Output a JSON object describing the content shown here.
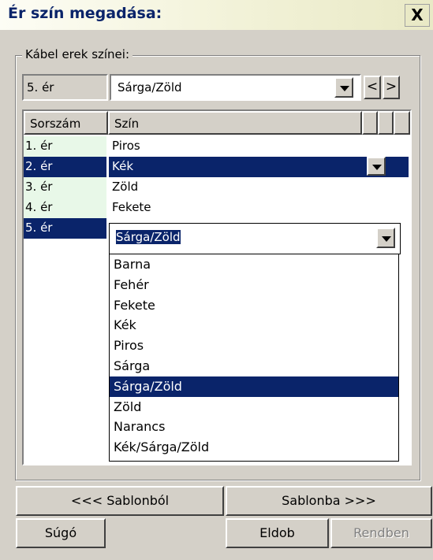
{
  "window": {
    "title": "Ér szín megadása:",
    "close_label": "X"
  },
  "group": {
    "label": "Kábel erek színei:"
  },
  "current": {
    "wire": "5. ér",
    "color": "Sárga/Zöld"
  },
  "nav": {
    "prev": "<",
    "next": ">"
  },
  "table": {
    "headers": [
      "Sorszám",
      "Szín"
    ],
    "rows": [
      {
        "num": "1. ér",
        "color": "Piros"
      },
      {
        "num": "2. ér",
        "color": "Kék"
      },
      {
        "num": "3. ér",
        "color": "Zöld"
      },
      {
        "num": "4. ér",
        "color": "Fekete"
      },
      {
        "num": "5. ér",
        "color": "Sárga/Zöld"
      }
    ]
  },
  "dropdown": {
    "options": [
      "Barna",
      "Fehér",
      "Fekete",
      "Kék",
      "Piros",
      "Sárga",
      "Sárga/Zöld",
      "Zöld",
      "Narancs",
      "Kék/Sárga/Zöld"
    ],
    "selected_index": 6
  },
  "buttons": {
    "from_template": "<<< Sablonból",
    "to_template": "Sablonba >>>",
    "help": "Súgó",
    "discard": "Eldob",
    "ok": "Rendben"
  },
  "colors": {
    "selection": "#0a246a",
    "title_text": "#0a246a",
    "face": "#d4d0c8",
    "row_green": "#e8f8e8"
  }
}
